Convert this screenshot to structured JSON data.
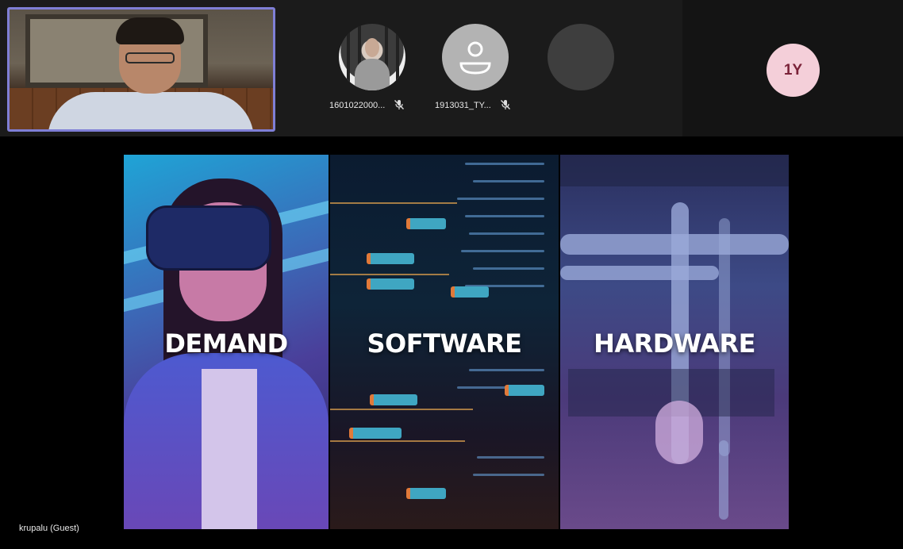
{
  "participants": {
    "self_tile": {
      "kind": "video"
    },
    "tiles": [
      {
        "name": "1601022000...",
        "avatar": "photo",
        "mic": "mic-off-icon"
      },
      {
        "name": "1913031_TY...",
        "avatar": "person-icon",
        "mic": "mic-off-icon"
      },
      {
        "name": "",
        "avatar": "blank"
      }
    ],
    "overflow": {
      "label": "1Y",
      "bg": "#f4cfd9",
      "fg": "#7a2238"
    }
  },
  "shared_screen": {
    "panels": [
      {
        "title": "DEMAND"
      },
      {
        "title": "SOFTWARE"
      },
      {
        "title": "HARDWARE"
      }
    ],
    "presenter_label": "krupalu (Guest)"
  },
  "colors": {
    "self_tile_border": "#7f7fd6",
    "strip_bg": "#1b1b1b"
  }
}
